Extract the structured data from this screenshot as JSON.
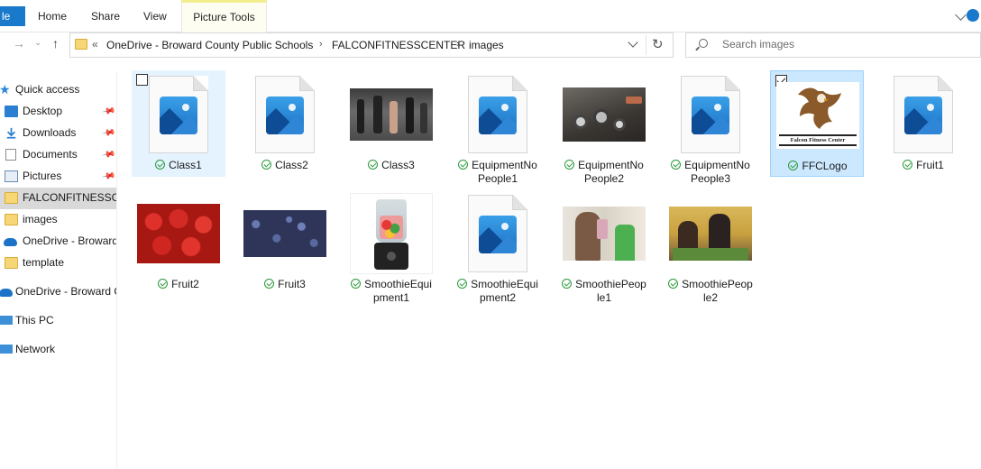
{
  "ribbon": {
    "file_label": "le",
    "tabs": [
      "Home",
      "Share",
      "View"
    ],
    "context_tab": "Picture Tools"
  },
  "address": {
    "overflow_glyph": "«",
    "crumbs": [
      "OneDrive - Broward County Public Schools",
      "FALCONFITNESSCENTER",
      "images"
    ],
    "separator": "›"
  },
  "search": {
    "placeholder": "Search images"
  },
  "sidebar": {
    "items": [
      {
        "label": "Quick access",
        "icon": "star-icon"
      },
      {
        "label": "Desktop",
        "icon": "desktop-icon",
        "pinned": true
      },
      {
        "label": "Downloads",
        "icon": "download-icon",
        "pinned": true
      },
      {
        "label": "Documents",
        "icon": "documents-icon",
        "pinned": true
      },
      {
        "label": "Pictures",
        "icon": "pictures-icon",
        "pinned": true
      },
      {
        "label": "FALCONFITNESSCENTER",
        "icon": "folder-icon",
        "selected": true
      },
      {
        "label": "images",
        "icon": "folder-icon"
      },
      {
        "label": "OneDrive - Broward County Public Schools",
        "icon": "cloud-icon"
      },
      {
        "label": "template",
        "icon": "folder-icon"
      },
      {
        "label": "OneDrive - Broward County Public Schools",
        "icon": "cloud-icon"
      },
      {
        "label": "This PC",
        "icon": "pc-icon"
      },
      {
        "label": "Network",
        "icon": "network-icon"
      }
    ]
  },
  "files": [
    {
      "name": "Class1",
      "kind": "generic",
      "state": "hover"
    },
    {
      "name": "Class2",
      "kind": "generic"
    },
    {
      "name": "Class3",
      "kind": "photo-class"
    },
    {
      "name": "EquipmentNoPeople1",
      "line1": "EquipmentNo",
      "line2": "People1",
      "kind": "generic"
    },
    {
      "name": "EquipmentNoPeople2",
      "line1": "EquipmentNo",
      "line2": "People2",
      "kind": "photo-equipment"
    },
    {
      "name": "EquipmentNoPeople3",
      "line1": "EquipmentNo",
      "line2": "People3",
      "kind": "generic"
    },
    {
      "name": "FFCLogo",
      "kind": "logo",
      "state": "selected",
      "logo_text": "Falcon Fitness Center"
    },
    {
      "name": "Fruit1",
      "kind": "generic"
    },
    {
      "name": "Fruit2",
      "kind": "photo-strawberry"
    },
    {
      "name": "Fruit3",
      "kind": "photo-blueberry"
    },
    {
      "name": "SmoothieEquipment1",
      "line1": "SmoothieEqui",
      "line2": "pment1",
      "kind": "photo-blender"
    },
    {
      "name": "SmoothieEquipment2",
      "line1": "SmoothieEqui",
      "line2": "pment2",
      "kind": "generic"
    },
    {
      "name": "SmoothiePeople1",
      "line1": "SmoothiePeop",
      "line2": "le1",
      "kind": "photo-people1"
    },
    {
      "name": "SmoothiePeople2",
      "line1": "SmoothiePeop",
      "line2": "le2",
      "kind": "photo-people2"
    }
  ]
}
